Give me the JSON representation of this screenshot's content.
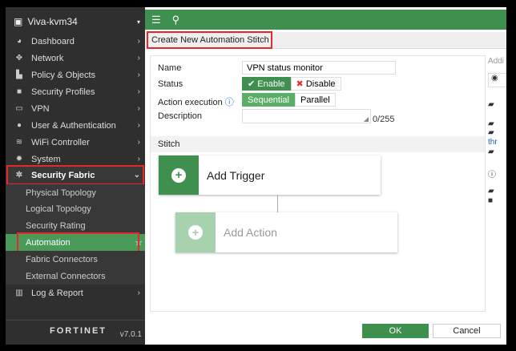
{
  "sidebar": {
    "device": "Viva-kvm34",
    "items": [
      {
        "label": "Dashboard",
        "icon": "dashboard-icon"
      },
      {
        "label": "Network",
        "icon": "network-icon"
      },
      {
        "label": "Policy & Objects",
        "icon": "policy-icon"
      },
      {
        "label": "Security Profiles",
        "icon": "lock-icon"
      },
      {
        "label": "VPN",
        "icon": "laptop-icon"
      },
      {
        "label": "User & Authentication",
        "icon": "user-icon"
      },
      {
        "label": "WiFi Controller",
        "icon": "wifi-icon"
      },
      {
        "label": "System",
        "icon": "gear-icon"
      },
      {
        "label": "Security Fabric",
        "icon": "fabric-icon"
      }
    ],
    "subitems": [
      "Physical Topology",
      "Logical Topology",
      "Security Rating",
      "Automation",
      "Fabric Connectors",
      "External Connectors"
    ],
    "log": "Log & Report",
    "brand": "FORTINET",
    "version": "v7.0.1"
  },
  "header": {
    "title": "Create New Automation Stitch"
  },
  "form": {
    "name_label": "Name",
    "name_value": "VPN status monitor",
    "status_label": "Status",
    "enable": "Enable",
    "disable": "Disable",
    "action_label": "Action execution",
    "sequential": "Sequential",
    "parallel": "Parallel",
    "desc_label": "Description",
    "desc_count": "0/255"
  },
  "stitch": {
    "header": "Stitch",
    "trigger": "Add Trigger",
    "action": "Add Action"
  },
  "right": {
    "title": "Addi",
    "link": "thr"
  },
  "footer": {
    "ok": "OK",
    "cancel": "Cancel"
  }
}
